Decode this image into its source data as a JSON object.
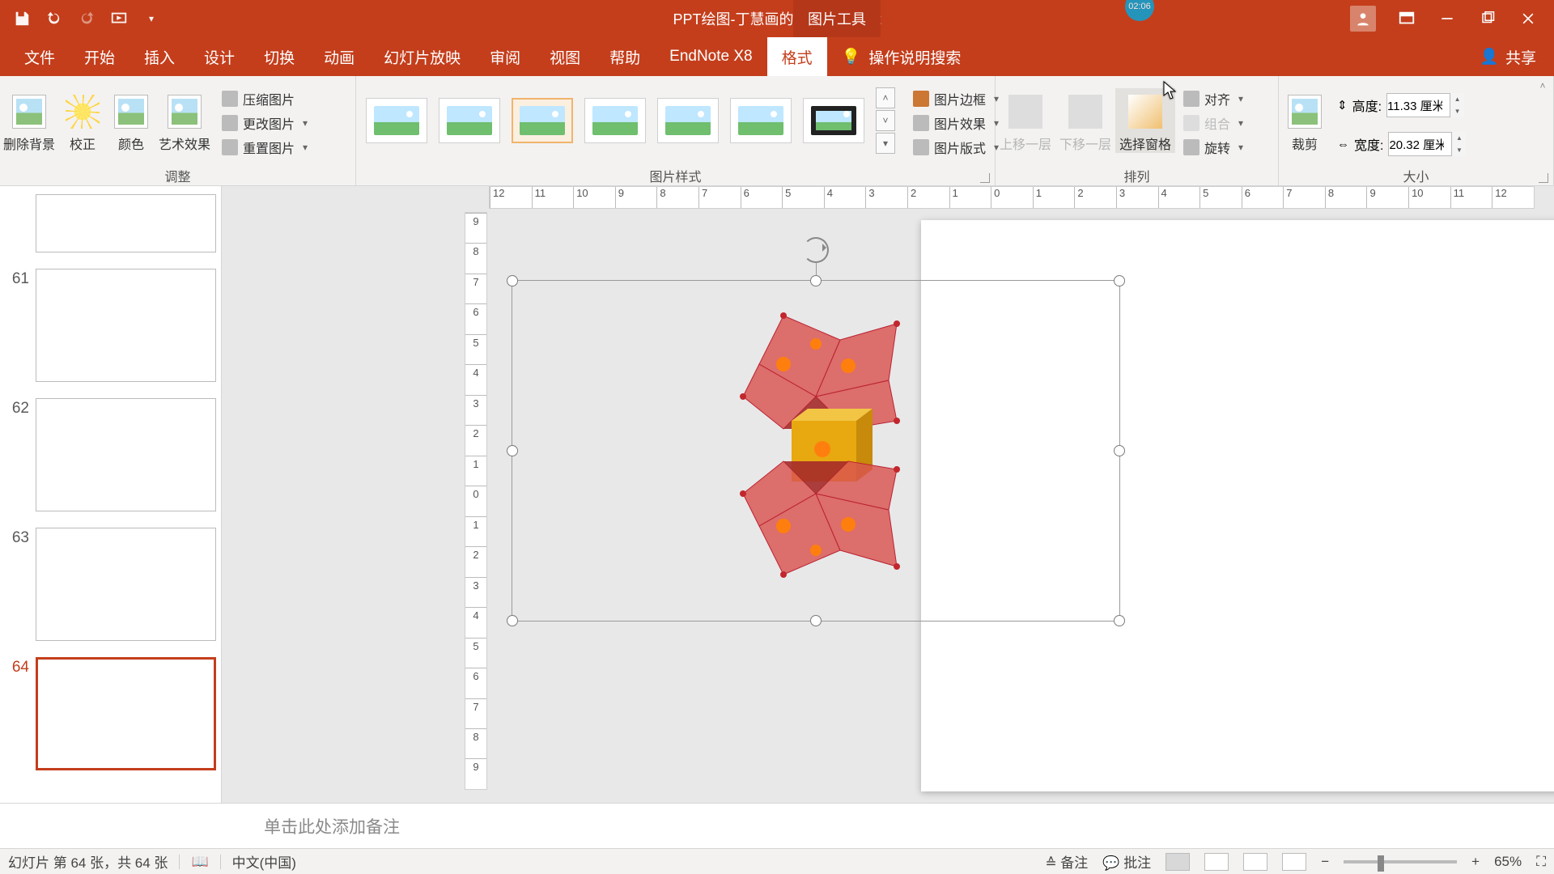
{
  "titlebar": {
    "title": "PPT绘图-丁慧画的 - PowerPoint",
    "context_tab": "图片工具",
    "badge": "02:06"
  },
  "menubar": {
    "tabs": [
      "文件",
      "开始",
      "插入",
      "设计",
      "切换",
      "动画",
      "幻灯片放映",
      "审阅",
      "视图",
      "帮助",
      "EndNote X8",
      "格式"
    ],
    "active_index": 11,
    "tellme": "操作说明搜索",
    "share": "共享"
  },
  "ribbon": {
    "groups": {
      "adjust": {
        "label": "调整",
        "remove_bg": "删除背景",
        "corrections": "校正",
        "color": "颜色",
        "artistic": "艺术效果",
        "compress": "压缩图片",
        "change": "更改图片",
        "reset": "重置图片"
      },
      "styles": {
        "label": "图片样式",
        "border": "图片边框",
        "effects": "图片效果",
        "layout": "图片版式"
      },
      "arrange": {
        "label": "排列",
        "forward": "上移一层",
        "backward": "下移一层",
        "selection_pane": "选择窗格",
        "align": "对齐",
        "group": "组合",
        "rotate": "旋转"
      },
      "size": {
        "label": "大小",
        "crop": "裁剪",
        "height_label": "高度:",
        "height_value": "11.33 厘米",
        "width_label": "宽度:",
        "width_value": "20.32 厘米"
      }
    }
  },
  "hruler": [
    "12",
    "11",
    "10",
    "9",
    "8",
    "7",
    "6",
    "5",
    "4",
    "3",
    "2",
    "1",
    "0",
    "1",
    "2",
    "3",
    "4",
    "5",
    "6",
    "7",
    "8",
    "9",
    "10",
    "11",
    "12"
  ],
  "vruler": [
    "9",
    "8",
    "7",
    "6",
    "5",
    "4",
    "3",
    "2",
    "1",
    "0",
    "1",
    "2",
    "3",
    "4",
    "5",
    "6",
    "7",
    "8",
    "9"
  ],
  "thumbs": {
    "items": [
      {
        "num": "",
        "half": true
      },
      {
        "num": "61"
      },
      {
        "num": "62"
      },
      {
        "num": "63"
      },
      {
        "num": "64",
        "selected": true
      }
    ]
  },
  "notes_placeholder": "单击此处添加备注",
  "statusbar": {
    "slide_info": "幻灯片 第 64 张，共 64 张",
    "language": "中文(中国)",
    "notes_btn": "备注",
    "comments_btn": "批注",
    "zoom": "65%"
  }
}
